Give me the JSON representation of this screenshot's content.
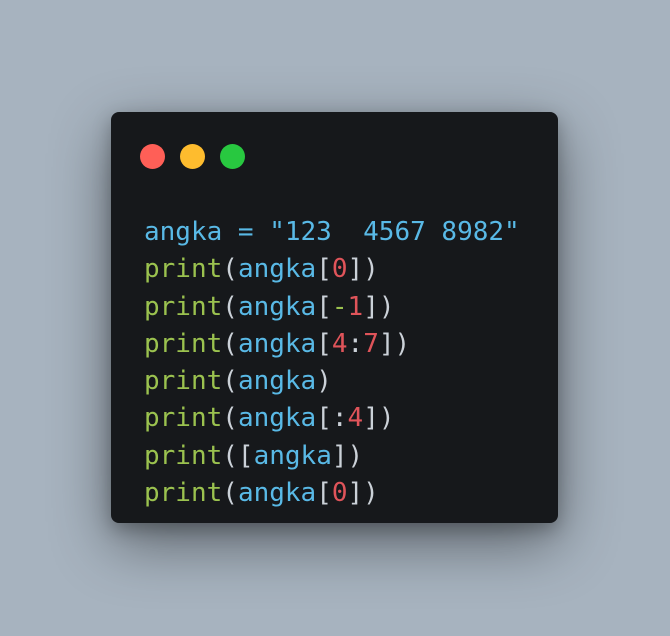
{
  "colors": {
    "background": "#a7b3bf",
    "window": "#16181b",
    "red": "#ff5f57",
    "yellow": "#febc2e",
    "green": "#28c840",
    "identifier": "#59b9e6",
    "keyword_function": "#9bc24f",
    "number": "#e0545a",
    "punctuation": "#cbd1d8"
  },
  "window_controls": [
    "close-dot",
    "minimize-dot",
    "maximize-dot"
  ],
  "code_lines": [
    [
      {
        "t": "angka = \"123  4567 8982\"",
        "c": "identifier"
      }
    ],
    [
      {
        "t": "print",
        "c": "keyword_function"
      },
      {
        "t": "(",
        "c": "punctuation"
      },
      {
        "t": "angka",
        "c": "identifier"
      },
      {
        "t": "[",
        "c": "punctuation"
      },
      {
        "t": "0",
        "c": "number"
      },
      {
        "t": "])",
        "c": "punctuation"
      }
    ],
    [
      {
        "t": "print",
        "c": "keyword_function"
      },
      {
        "t": "(",
        "c": "punctuation"
      },
      {
        "t": "angka",
        "c": "identifier"
      },
      {
        "t": "[",
        "c": "punctuation"
      },
      {
        "t": "-",
        "c": "keyword_function"
      },
      {
        "t": "1",
        "c": "number"
      },
      {
        "t": "])",
        "c": "punctuation"
      }
    ],
    [
      {
        "t": "print",
        "c": "keyword_function"
      },
      {
        "t": "(",
        "c": "punctuation"
      },
      {
        "t": "angka",
        "c": "identifier"
      },
      {
        "t": "[",
        "c": "punctuation"
      },
      {
        "t": "4",
        "c": "number"
      },
      {
        "t": ":",
        "c": "punctuation"
      },
      {
        "t": "7",
        "c": "number"
      },
      {
        "t": "])",
        "c": "punctuation"
      }
    ],
    [
      {
        "t": "print",
        "c": "keyword_function"
      },
      {
        "t": "(",
        "c": "punctuation"
      },
      {
        "t": "angka",
        "c": "identifier"
      },
      {
        "t": ")",
        "c": "punctuation"
      }
    ],
    [
      {
        "t": "print",
        "c": "keyword_function"
      },
      {
        "t": "(",
        "c": "punctuation"
      },
      {
        "t": "angka",
        "c": "identifier"
      },
      {
        "t": "[:",
        "c": "punctuation"
      },
      {
        "t": "4",
        "c": "number"
      },
      {
        "t": "])",
        "c": "punctuation"
      }
    ],
    [
      {
        "t": "print",
        "c": "keyword_function"
      },
      {
        "t": "([",
        "c": "punctuation"
      },
      {
        "t": "angka",
        "c": "identifier"
      },
      {
        "t": "])",
        "c": "punctuation"
      }
    ],
    [
      {
        "t": "print",
        "c": "keyword_function"
      },
      {
        "t": "(",
        "c": "punctuation"
      },
      {
        "t": "angka",
        "c": "identifier"
      },
      {
        "t": "[",
        "c": "punctuation"
      },
      {
        "t": "0",
        "c": "number"
      },
      {
        "t": "])",
        "c": "punctuation"
      }
    ]
  ]
}
